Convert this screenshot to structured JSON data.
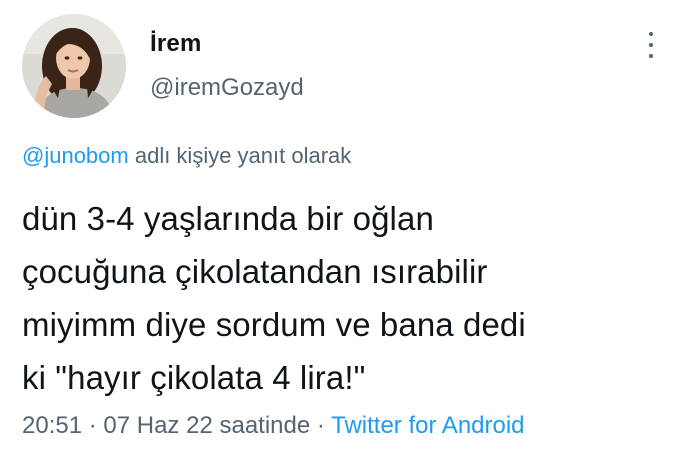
{
  "author": {
    "name": "İrem",
    "handle": "@iremGozayd"
  },
  "reply": {
    "mention": "@junobom",
    "suffix": " adlı kişiye yanıt olarak"
  },
  "tweet": {
    "lines": [
      "dün 3-4 yaşlarında bir oğlan",
      "çocuğuna çikolatandan ısırabilir",
      "miyimm diye sordum ve bana dedi",
      "ki \"hayır çikolata 4 lira!\""
    ]
  },
  "meta": {
    "time": "20:51",
    "separator1": " · ",
    "date": "07 Haz 22 saatinde",
    "separator2": " · ",
    "source": "Twitter for Android"
  },
  "icons": {
    "more": "more-vertical-icon"
  },
  "colors": {
    "link": "#1d9bf0",
    "secondary": "#536471",
    "text": "#0f1419"
  }
}
